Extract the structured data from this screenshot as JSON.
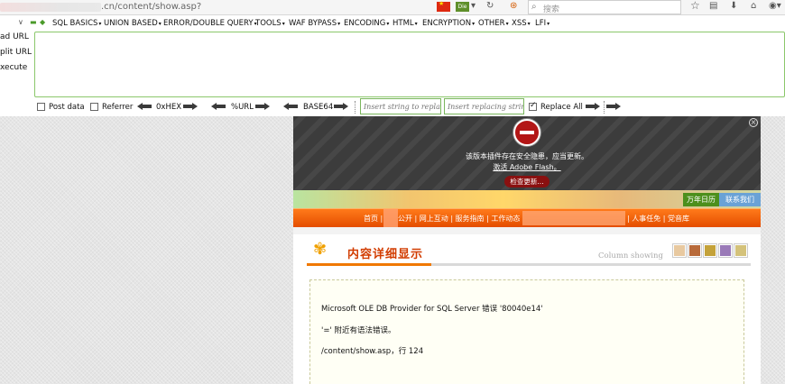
{
  "browser": {
    "url": ".cn/content/show.asp?",
    "search_placeholder": "搜索",
    "addon_badge": "Die"
  },
  "hackbar": {
    "side": [
      "ad URL",
      "plit URL",
      "xecute"
    ],
    "menu": [
      "SQL BASICS",
      "UNION BASED",
      "ERROR/DOUBLE QUERY",
      "TOOLS",
      "WAF BYPASS",
      "ENCODING",
      "HTML",
      "ENCRYPTION",
      "OTHER",
      "XSS",
      "LFI"
    ],
    "options": {
      "post_data": "Post data",
      "referrer": "Referrer",
      "hex": "0xHEX",
      "url": "%URL",
      "base64": "BASE64",
      "replace_placeholder": "Insert string to replace",
      "replacing_placeholder": "Insert replacing string",
      "replace_all": "Replace All"
    }
  },
  "flash": {
    "message": "该版本插件存在安全隐患，应当更新。",
    "link": "激活 Adobe Flash。",
    "button": "检查更新..."
  },
  "site": {
    "calendar": "万年日历",
    "contact": "联系我们",
    "nav_left": "首页 |",
    "nav_mid": "公开 | 网上互动 | 服务指南 | 工作动态",
    "nav_right": "| 人事任免 | 党音库",
    "content_title": "内容详细显示",
    "content_en": "Column showing"
  },
  "error": {
    "line1": "Microsoft OLE DB Provider for SQL Server 错误 '80040e14'",
    "line2": "'=' 附近有语法错误。",
    "line3": "/content/show.asp，行 124"
  },
  "colors": {
    "hackbar_border": "#8bc76b",
    "nav_orange": "#e44d00",
    "title_red": "#d23c00",
    "flash_stop": "#b31616"
  }
}
